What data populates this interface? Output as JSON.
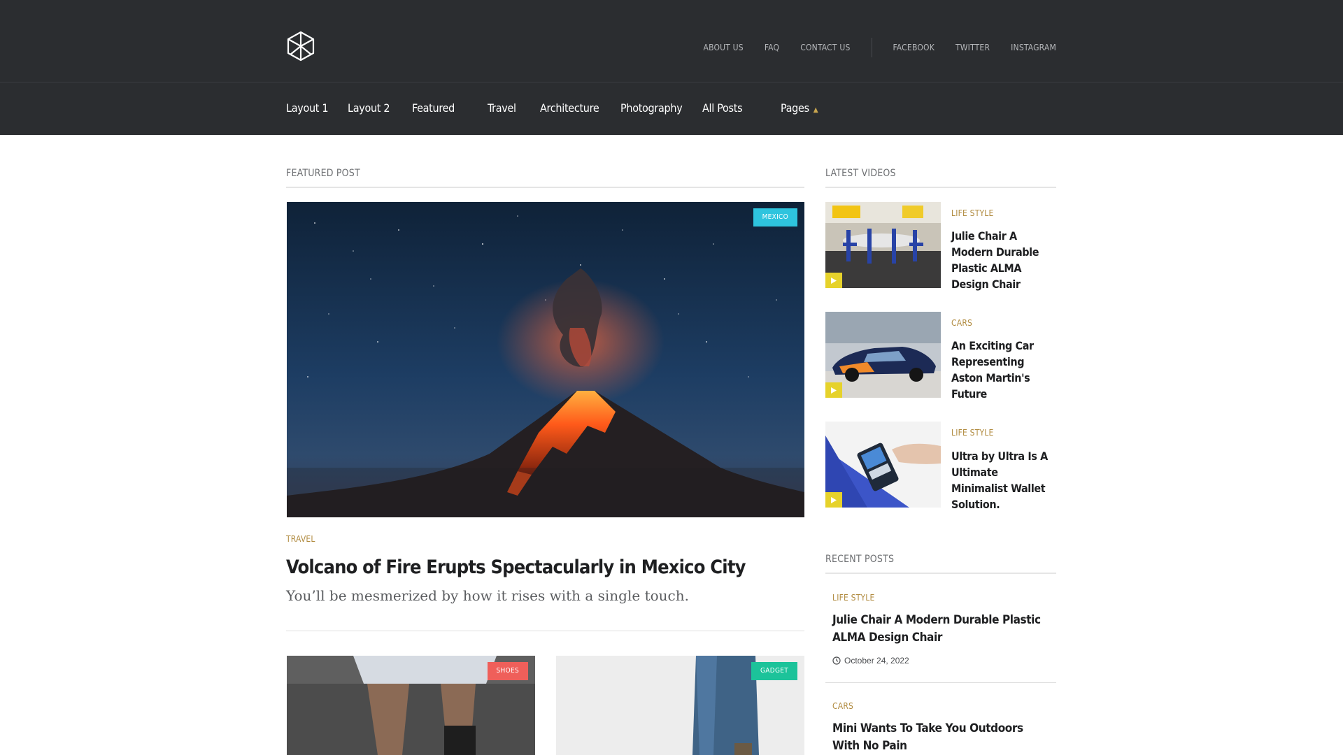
{
  "header": {
    "top_links": [
      "ABOUT US",
      "FAQ",
      "CONTACT US"
    ],
    "social_links": [
      "FACEBOOK",
      "TWITTER",
      "INSTAGRAM"
    ]
  },
  "nav": {
    "items": [
      "Layout 1",
      "Layout 2",
      "Featured",
      "Travel",
      "Architecture",
      "Photography",
      "All Posts",
      "Pages"
    ]
  },
  "featured": {
    "section_title": "FEATURED POST",
    "badge": "MEXICO",
    "category": "TRAVEL",
    "title": "Volcano of Fire Erupts Spectacularly in Mexico City",
    "subtitle": "You’ll be mesmerized by how it rises with a single touch."
  },
  "cards": [
    {
      "badge": "SHOES"
    },
    {
      "badge": "GADGET"
    }
  ],
  "videos": {
    "section_title": "LATEST VIDEOS",
    "items": [
      {
        "category": "LIFE STYLE",
        "title": "Julie Chair A Modern Durable Plastic ALMA Design Chair"
      },
      {
        "category": "CARS",
        "title": "An Exciting Car Representing Aston Martin's Future"
      },
      {
        "category": "LIFE STYLE",
        "title": "Ultra by Ultra Is A Ultimate Minimalist Wallet Solution."
      }
    ]
  },
  "recent": {
    "section_title": "RECENT POSTS",
    "items": [
      {
        "category": "LIFE STYLE",
        "title": "Julie Chair A Modern Durable Plastic ALMA Design Chair",
        "date": "October 24, 2022"
      },
      {
        "category": "CARS",
        "title": "Mini Wants To Take You Outdoors With No Pain"
      }
    ]
  },
  "colors": {
    "header_bg": "#2b2d30",
    "category_gold": "#b08a3e",
    "badge_mexico": "#2ec4de",
    "badge_shoes": "#ef5f5a",
    "badge_gadget": "#1cc39a",
    "play_yellow": "#e6d22b"
  },
  "icons": {
    "logo": "hexagon-cube-logo",
    "play": "play-icon",
    "nav_pages": "chevron-up-icon",
    "date": "clock-icon"
  }
}
